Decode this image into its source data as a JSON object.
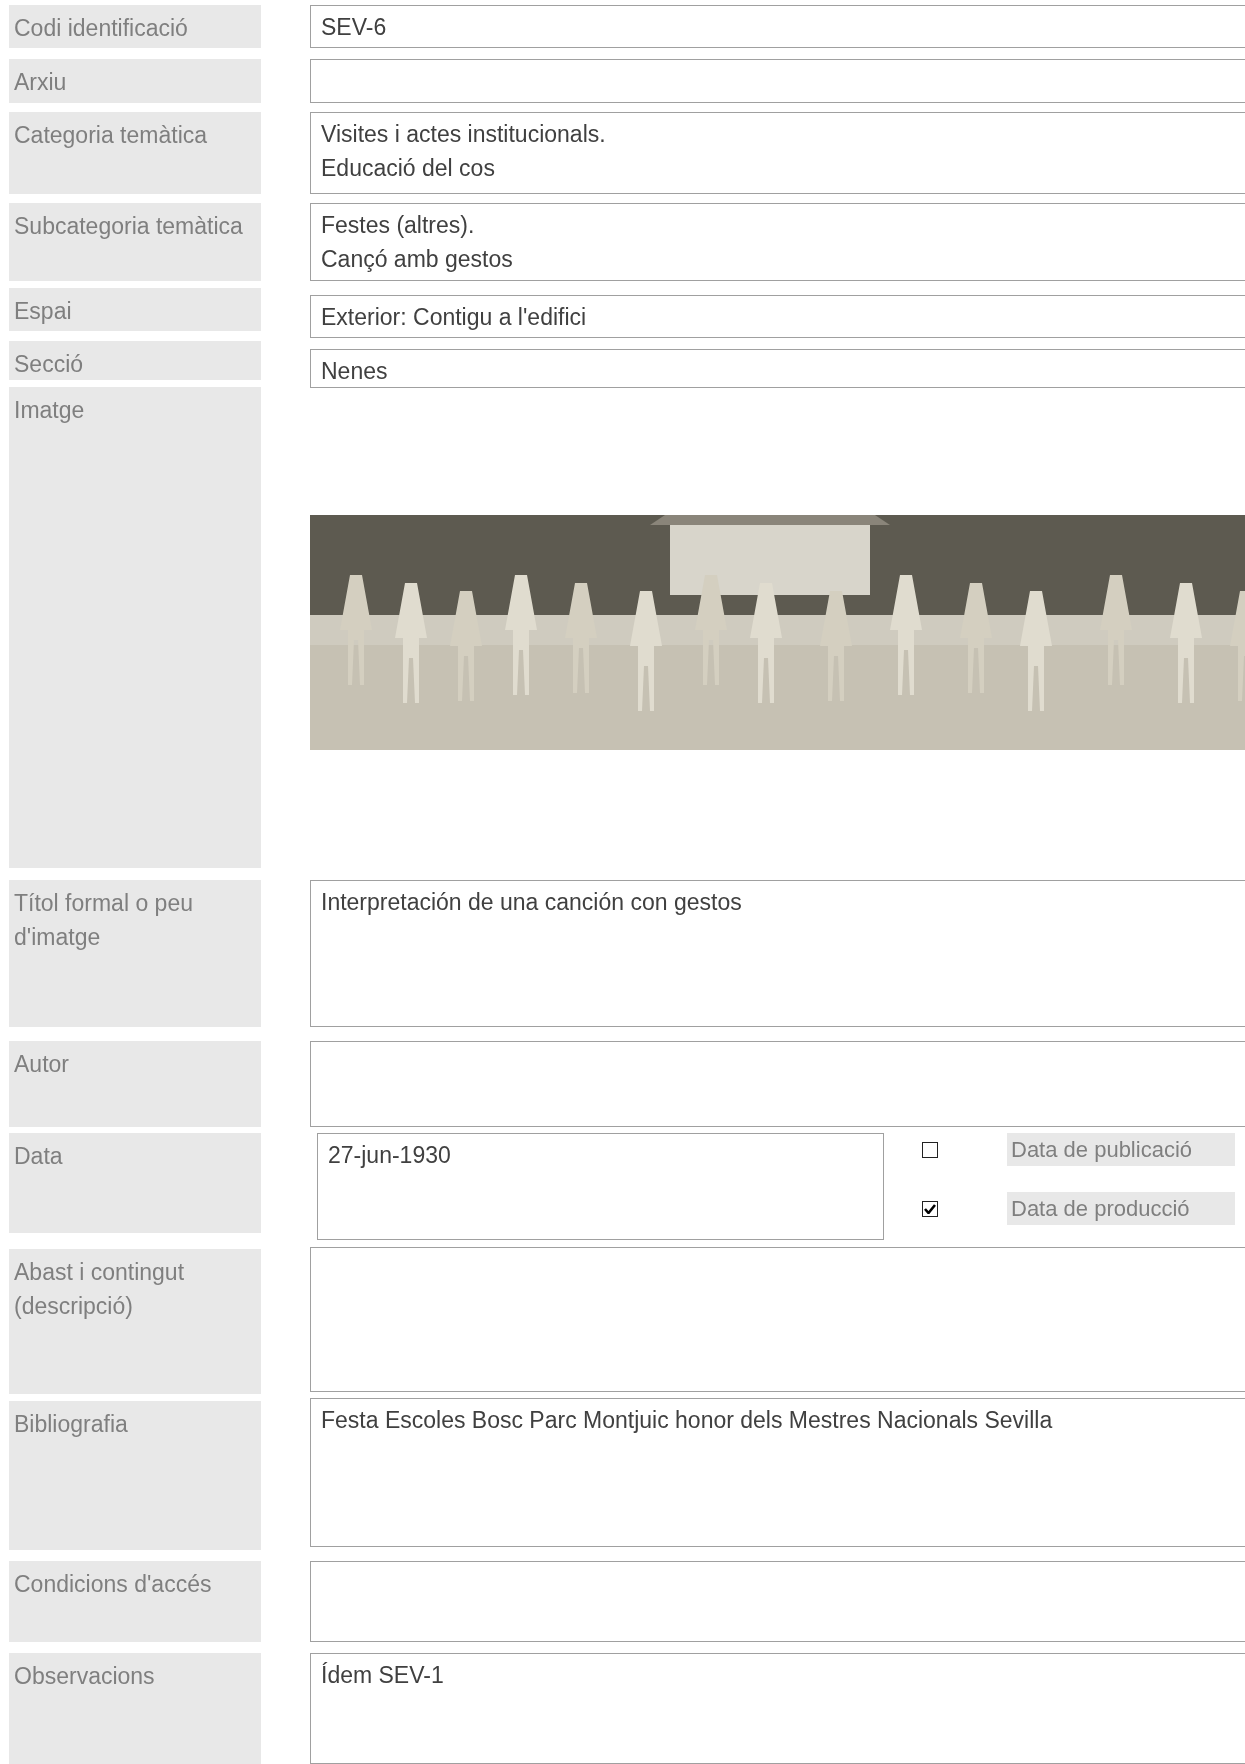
{
  "fields": [
    {
      "kind": "text",
      "label": "Codi identificació",
      "lines": [
        "SEV-6"
      ]
    },
    {
      "kind": "text",
      "label": "Arxiu"
    },
    {
      "kind": "text",
      "label": "Categoria temàtica",
      "lines": [
        "Visites i actes institucionals.",
        "Educació del cos"
      ]
    },
    {
      "kind": "text",
      "label": "Subcategoria temàtica",
      "lines": [
        "Festes (altres).",
        "Cançó amb gestos"
      ]
    },
    {
      "kind": "text",
      "label": "Espai",
      "lines": [
        "Exterior: Contigu a l'edifici"
      ]
    },
    {
      "kind": "text",
      "label": "Secció",
      "lines": [
        "Nenes"
      ]
    },
    {
      "label": "Imatge"
    },
    {
      "kind": "text",
      "label": "Títol formal o peu d'imatge",
      "lines": [
        "Interpretación de una canción con gestos"
      ]
    },
    {
      "kind": "text",
      "label": "Autor"
    },
    {
      "kind": "date",
      "label": "Data",
      "lines": [
        "27-jun-1930"
      ],
      "options": [
        {
          "label": "Data de publicació",
          "checked": false
        },
        {
          "label": "Data de producció",
          "checked": true
        }
      ]
    },
    {
      "kind": "text",
      "label": "Abast i contingut (descripció)"
    },
    {
      "kind": "text",
      "label": "Bibliografia",
      "lines": [
        "Festa Escoles Bosc Parc Montjuic honor dels Mestres Nacionals Sevilla"
      ]
    },
    {
      "kind": "text",
      "label": "Condicions d'accés"
    },
    {
      "kind": "text",
      "label": "Observacions",
      "lines": [
        "Ídem SEV-1"
      ]
    }
  ]
}
